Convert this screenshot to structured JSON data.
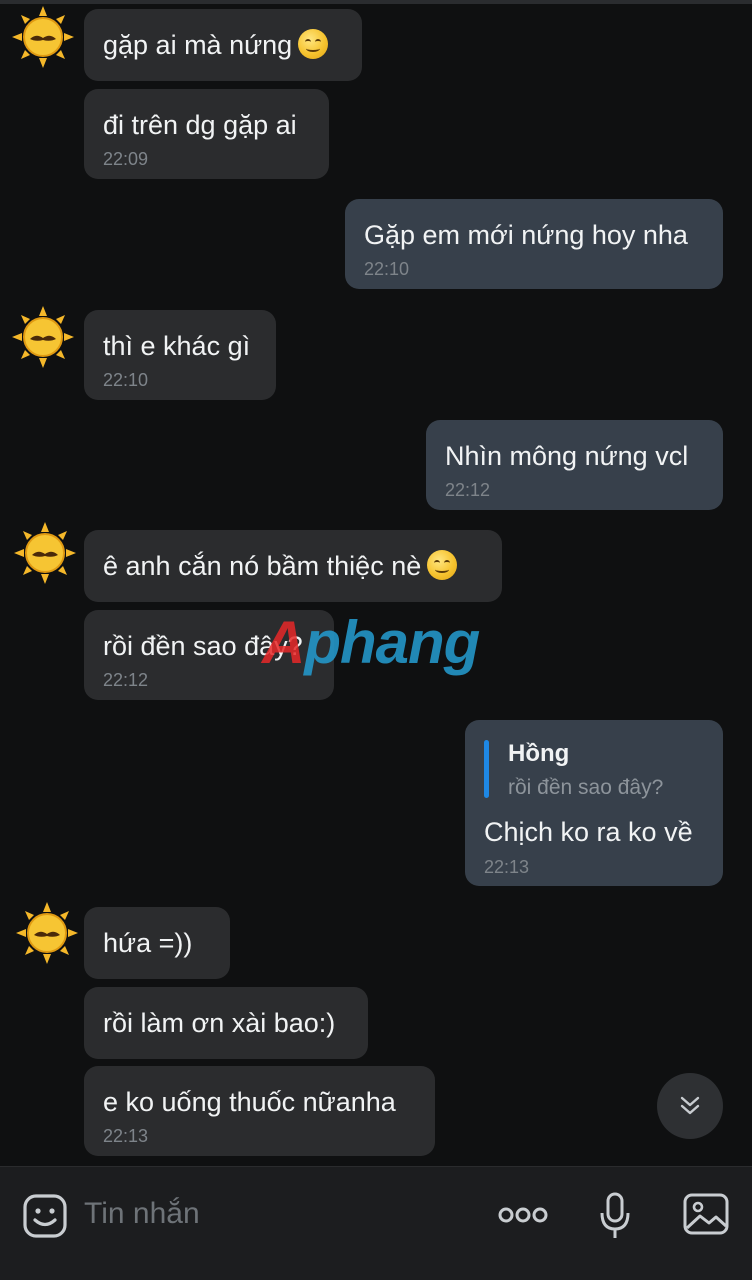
{
  "messages": [
    {
      "side": "in",
      "text": "gặp ai mà nứng",
      "emoji": "smile-emoji",
      "time": ""
    },
    {
      "side": "in",
      "text": "đi trên dg gặp ai",
      "time": "22:09"
    },
    {
      "side": "out",
      "text": "Gặp em mới nứng hoy nha",
      "time": "22:10"
    },
    {
      "side": "in",
      "text": "thì e khác gì",
      "time": "22:10"
    },
    {
      "side": "out",
      "text": "Nhìn mông nứng vcl",
      "time": "22:12"
    },
    {
      "side": "in",
      "text": "ê anh cắn nó bầm thiệc nè",
      "emoji": "smile-emoji",
      "time": ""
    },
    {
      "side": "in",
      "text": "rồi đền sao đây?",
      "time": "22:12"
    },
    {
      "side": "out",
      "reply_name": "Hồng",
      "reply_text": "rồi đền sao đây?",
      "text": "Chịch ko ra ko về",
      "time": "22:13"
    },
    {
      "side": "in",
      "text": "hứa =))",
      "time": ""
    },
    {
      "side": "in",
      "text": "rồi làm ơn xài bao:)",
      "time": ""
    },
    {
      "side": "in",
      "text": "e ko uống thuốc nữanha",
      "time": "22:13"
    }
  ],
  "watermark": {
    "first": "A",
    "rest": "phang"
  },
  "input": {
    "placeholder": "Tin nhắn"
  },
  "icons": [
    "sticker-icon",
    "more-icon",
    "microphone-icon",
    "image-icon",
    "scroll-down-icon",
    "sun-mustache-avatar-icon"
  ],
  "colors": {
    "background": "#0f1011",
    "incoming": "#2b2c2e",
    "outgoing": "#37404b",
    "accent": "#1e88e5"
  }
}
